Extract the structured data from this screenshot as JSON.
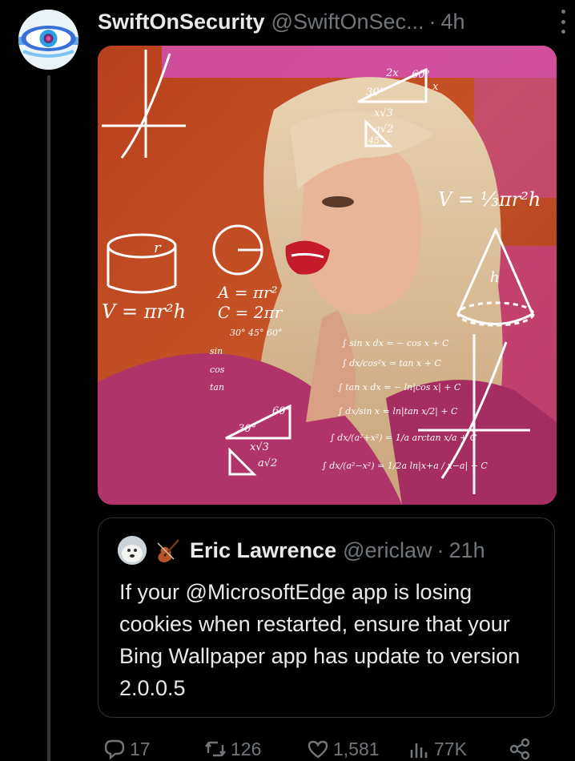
{
  "tweet": {
    "author_name": "SwiftOnSecurity",
    "author_handle": "@SwiftOnSec...",
    "separator": "·",
    "time": "4h",
    "media": {
      "formulas": {
        "v_cylinder": "V = πr²h",
        "area": "A = πr²",
        "circumference": "C = 2πr",
        "cone": "V = ⅓πr²h",
        "r": "r",
        "h": "h",
        "deg30": "30°",
        "deg60": "60°",
        "deg45": "45°",
        "two_x": "2x",
        "x": "x",
        "x_sqrt3": "x√3",
        "a_sqrt2": "a√2",
        "a": "a",
        "sin_int": "∫ sin x dx = − cos x + C",
        "sec_int": "∫ dx/cos²x = tan x + C",
        "tan_int": "∫ tan x dx = − ln|cos x| + C",
        "csc_int": "∫ dx/sin x = ln|tan x/2| + C",
        "arctan_int": "∫ dx/(a²+x²) = 1/a arctan x/a + C",
        "log_int": "∫ dx/(a²−x²) = 1/2a ln|x+a / x−a| + C",
        "table_header": "30°  45°  60°",
        "sin_row": "sin",
        "cos_row": "cos",
        "tan_row": "tan"
      }
    },
    "quote": {
      "name": "Eric Lawrence",
      "handle": "@ericlaw",
      "separator": "·",
      "time": "21h",
      "text": "If your @MicrosoftEdge app is losing cookies when restarted, ensure that your Bing Wallpaper app has update to version 2.0.0.5"
    },
    "actions": {
      "replies": "17",
      "retweets": "126",
      "likes": "1,581",
      "views": "77K"
    },
    "icons": {
      "reply": "reply-icon",
      "retweet": "retweet-icon",
      "like": "heart-icon",
      "views": "views-icon",
      "share": "share-icon",
      "more": "more-icon"
    }
  }
}
